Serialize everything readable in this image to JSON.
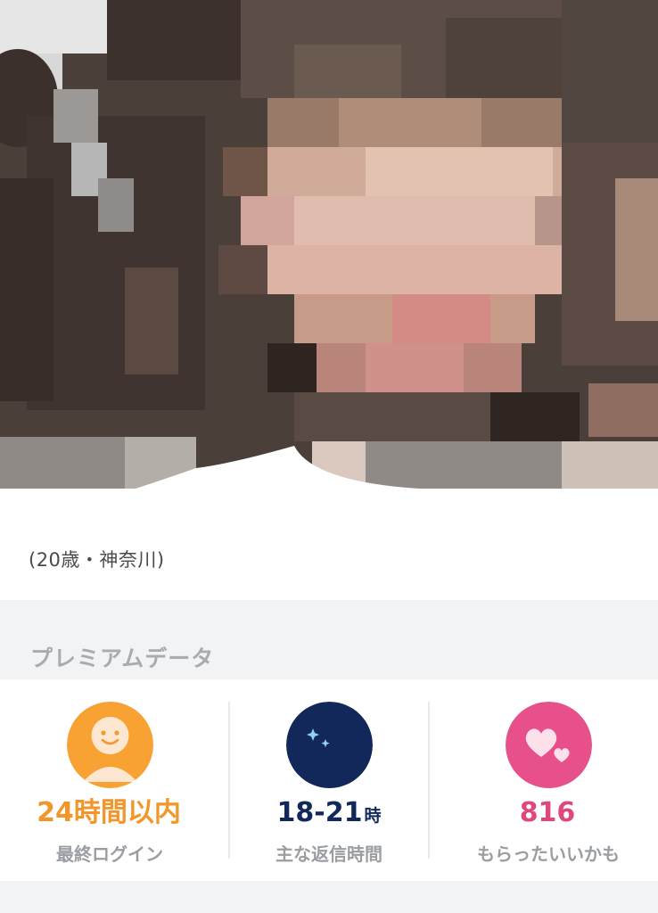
{
  "profile": {
    "age_location": "(20歳・神奈川)"
  },
  "premium": {
    "section_title": "プレミアムデータ",
    "stats": [
      {
        "icon": "smiley-user-icon",
        "value": "24時間以内",
        "unit": "",
        "label": "最終ログイン",
        "color": "#f2962a"
      },
      {
        "icon": "moon-stars-icon",
        "value": "18-21",
        "unit": "時",
        "label": "主な返信時間",
        "color": "#12275a"
      },
      {
        "icon": "hearts-icon",
        "value": "816",
        "unit": "",
        "label": "もらったいいかも",
        "color": "#e0477f"
      }
    ]
  }
}
